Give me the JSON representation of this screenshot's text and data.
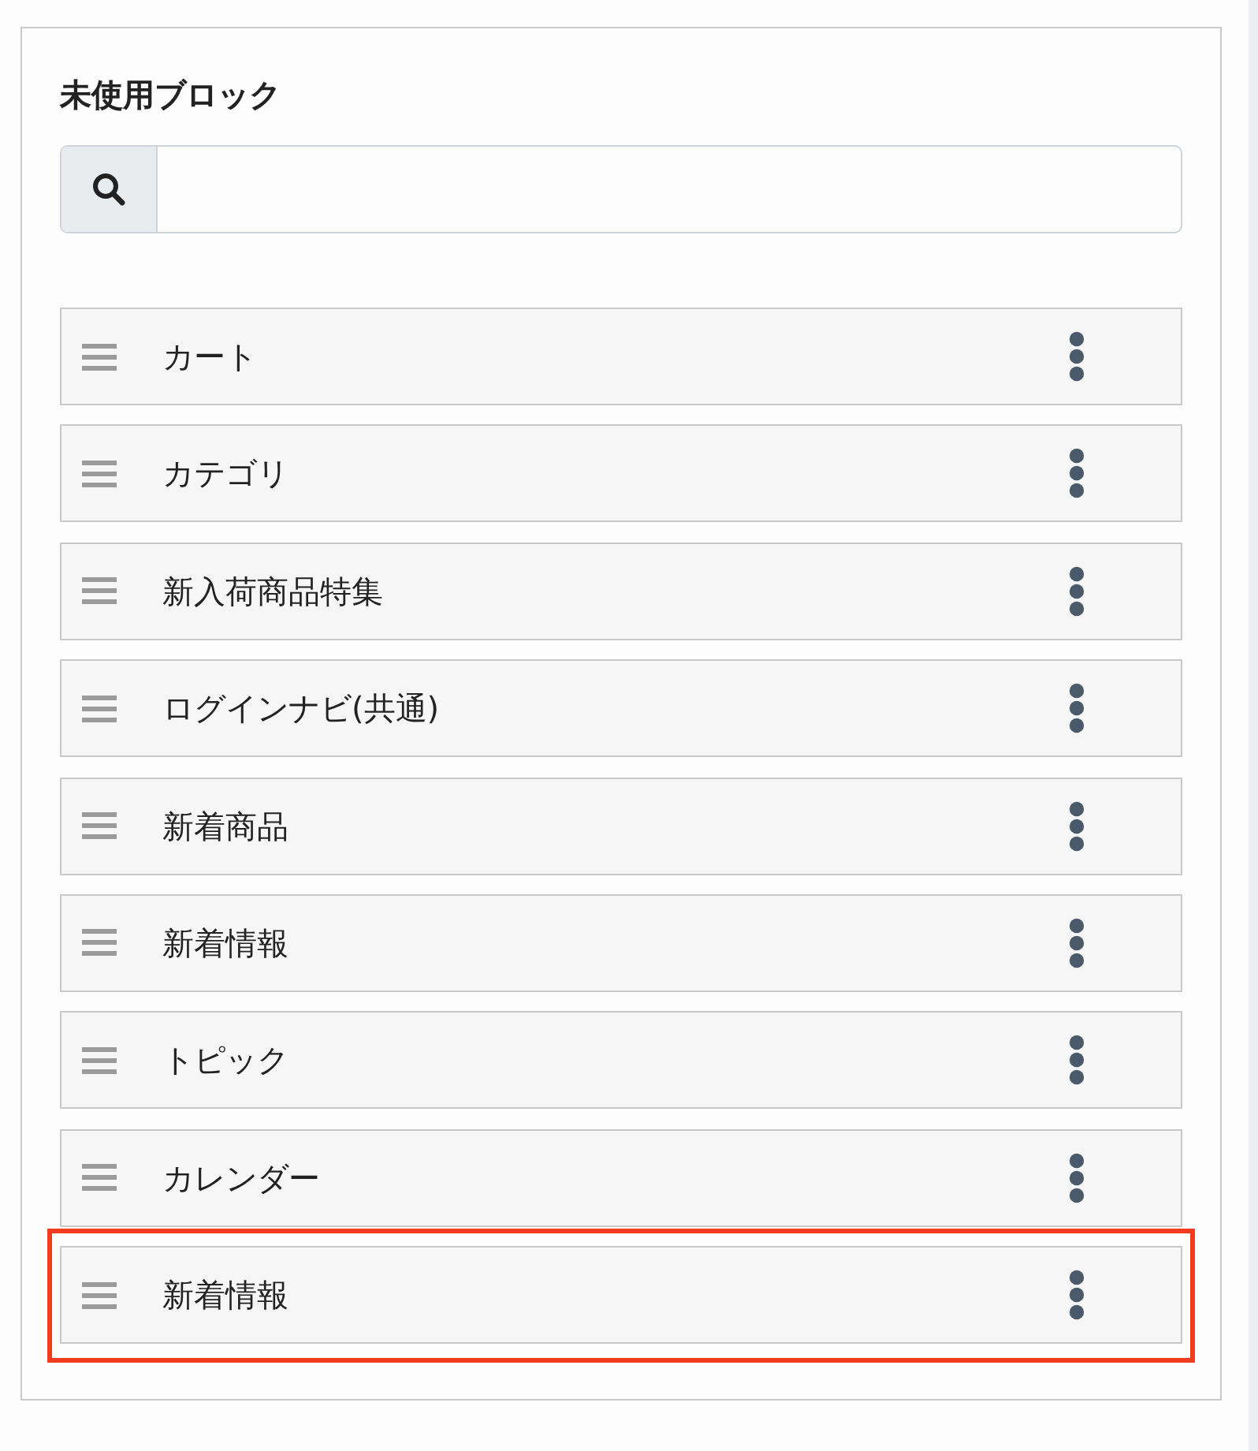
{
  "panel": {
    "title": "未使用ブロック"
  },
  "blocks": [
    {
      "label": "カート",
      "highlighted": false
    },
    {
      "label": "カテゴリ",
      "highlighted": false
    },
    {
      "label": "新入荷商品特集",
      "highlighted": false
    },
    {
      "label": "ログインナビ(共通)",
      "highlighted": false
    },
    {
      "label": "新着商品",
      "highlighted": false
    },
    {
      "label": "新着情報",
      "highlighted": false
    },
    {
      "label": "トピック",
      "highlighted": false
    },
    {
      "label": "カレンダー",
      "highlighted": false
    },
    {
      "label": "新着情報",
      "highlighted": true
    }
  ]
}
